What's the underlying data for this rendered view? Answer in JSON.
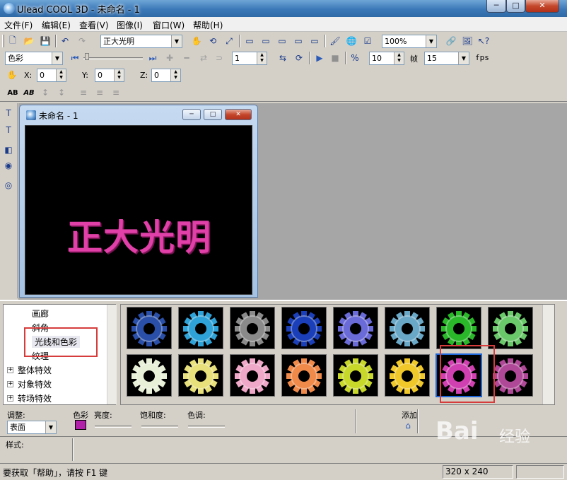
{
  "window": {
    "title": "Ulead COOL 3D - 未命名 - 1",
    "minimize": "─",
    "maximize": "□",
    "close": "✕"
  },
  "menu": [
    "文件(F)",
    "编辑(E)",
    "查看(V)",
    "图像(I)",
    "窗口(W)",
    "帮助(H)"
  ],
  "toolbar1": {
    "text_combo": "正大光明",
    "zoom_combo": "100%"
  },
  "toolbar2": {
    "mode_combo": "色彩",
    "frame_value": "1",
    "fps_frames": "10",
    "frame_label": "帧",
    "fps_value": "15",
    "fps_label": "fps"
  },
  "toolbar3": {
    "x_label": "X:",
    "x_value": "0",
    "y_label": "Y:",
    "y_value": "0",
    "z_label": "Z:",
    "z_value": "0"
  },
  "toolbar4": {
    "bold_ab": "AB",
    "bold_ab2": "AB"
  },
  "child_window": {
    "title": "未命名 - 1",
    "canvas_text": "正大光明"
  },
  "tree": {
    "items": [
      {
        "label": "画廊",
        "expandable": false
      },
      {
        "label": "斜角",
        "expandable": false
      },
      {
        "label": "光线和色彩",
        "expandable": false,
        "selected": true
      },
      {
        "label": "纹理",
        "expandable": false
      },
      {
        "label": "整体特效",
        "expandable": true
      },
      {
        "label": "对象特效",
        "expandable": true
      },
      {
        "label": "转场特效",
        "expandable": true
      }
    ]
  },
  "gallery": {
    "colors_row1": [
      "#2a4fa8",
      "#2fa3d8",
      "#8a8a8a",
      "#1a3fb8",
      "#6a6ad8",
      "#6aa8c8",
      "#2ab82a",
      "#6ac86a"
    ],
    "colors_row2": [
      "#e8f0d8",
      "#e8e07a",
      "#f0a8c8",
      "#f08a4a",
      "#c8d82a",
      "#f0c82a",
      "#d040b0",
      "#b04898"
    ],
    "selected_index": 14
  },
  "properties": {
    "adjust_label": "调整:",
    "adjust_value": "表面",
    "color_label": "色彩",
    "color_swatch": "#b020a8",
    "brightness_label": "亮度:",
    "saturation_label": "饱和度:",
    "hue_label": "色调:",
    "add_label": "添加",
    "style_label": "样式:"
  },
  "status": {
    "help_text": "要获取「帮助」，请按 F1 键",
    "size": "320 x 240"
  },
  "watermark": {
    "logo": "Bai",
    "text": "经验"
  }
}
